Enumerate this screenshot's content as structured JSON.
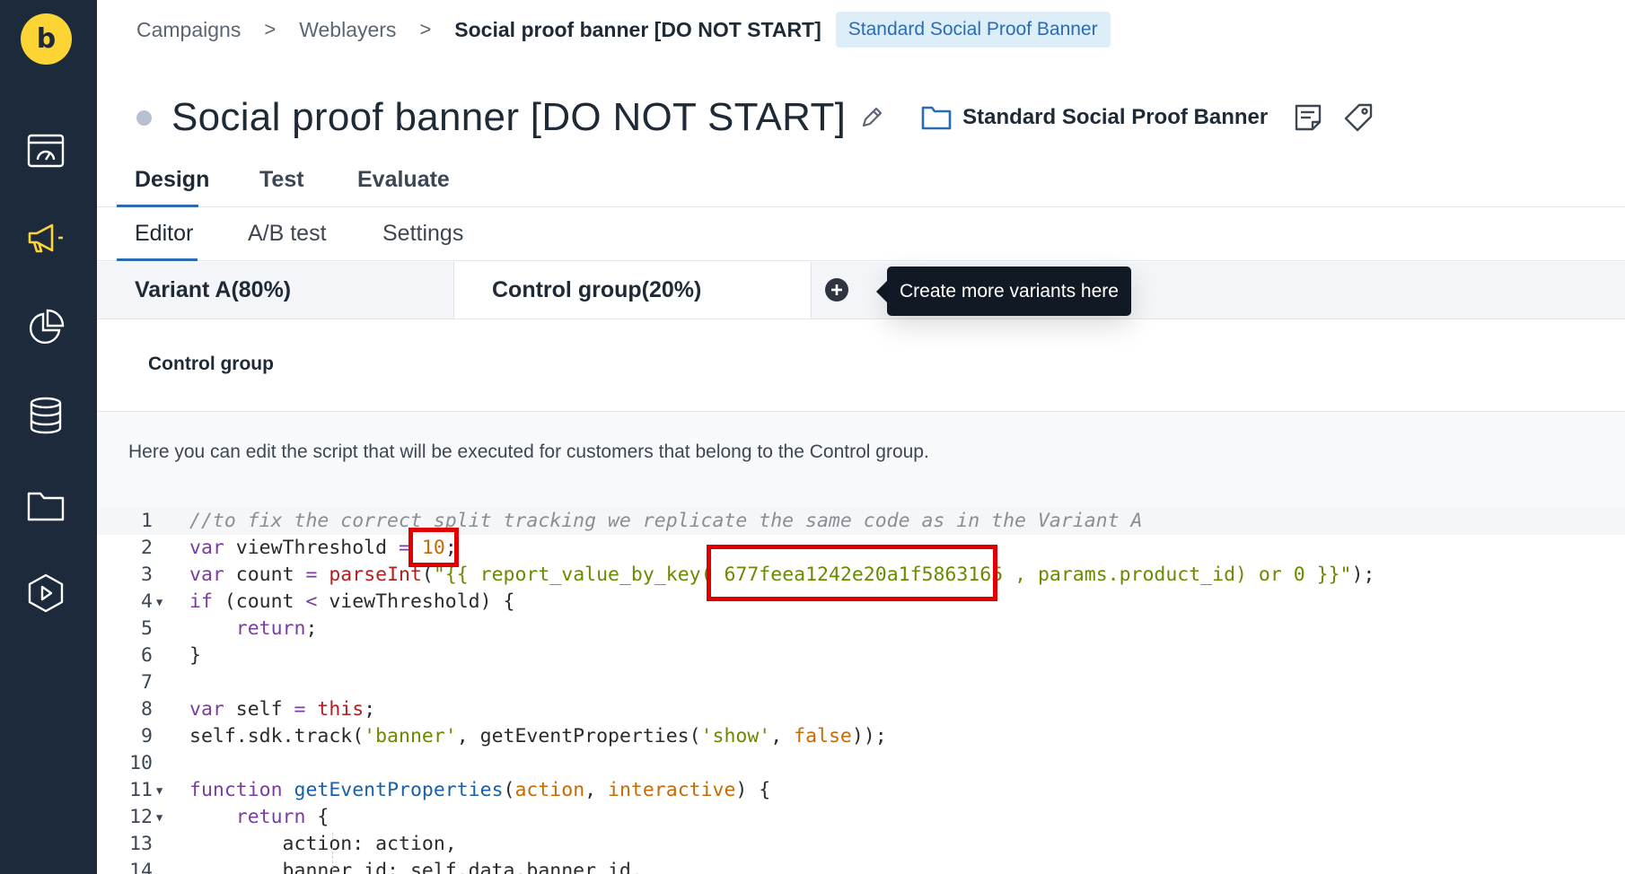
{
  "app": {
    "logo_letter": "b"
  },
  "sidebar": {
    "items": [
      {
        "name": "dashboard",
        "icon": "dashboard-gauge-icon"
      },
      {
        "name": "campaigns",
        "icon": "megaphone-icon",
        "active": true
      },
      {
        "name": "analytics",
        "icon": "pie-chart-icon"
      },
      {
        "name": "data",
        "icon": "database-icon"
      },
      {
        "name": "assets",
        "icon": "folder-icon"
      },
      {
        "name": "playbooks",
        "icon": "play-hexagon-icon"
      }
    ],
    "colors": {
      "background": "#1c2a3b",
      "active": "#fcd535",
      "inactive": "#ffffff"
    }
  },
  "breadcrumb": {
    "items": [
      "Campaigns",
      "Weblayers",
      "Social proof banner [DO NOT START]"
    ],
    "separator": ">",
    "badge": "Standard Social Proof Banner"
  },
  "header": {
    "title": "Social proof banner [DO NOT START]",
    "folder_label": "Standard Social Proof Banner"
  },
  "tabs_primary": [
    "Design",
    "Test",
    "Evaluate"
  ],
  "tabs_secondary": [
    "Editor",
    "A/B test",
    "Settings"
  ],
  "variants": {
    "items": [
      "Variant A(80%)",
      "Control group(20%)"
    ],
    "tooltip": "Create more variants here"
  },
  "section": {
    "label": "Control group",
    "description": "Here you can edit the script that will be executed for customers that belong to the Control group."
  },
  "code": {
    "line_numbers": [
      "1",
      "2",
      "3",
      "4",
      "5",
      "6",
      "7",
      "8",
      "9",
      "10",
      "11",
      "12",
      "13",
      "14"
    ],
    "lines": [
      {
        "parts": [
          {
            "t": "//to fix the correct split tracking we replicate the same code as in the Variant A",
            "c": "c-comment"
          }
        ]
      },
      {
        "parts": [
          {
            "t": "var",
            "c": "c-kw"
          },
          {
            "t": " viewThreshold ",
            "c": ""
          },
          {
            "t": "=",
            "c": "c-op"
          },
          {
            "t": " ",
            "c": ""
          },
          {
            "t": "10",
            "c": "c-num"
          },
          {
            "t": ";",
            "c": ""
          }
        ]
      },
      {
        "parts": [
          {
            "t": "var",
            "c": "c-kw"
          },
          {
            "t": " count ",
            "c": ""
          },
          {
            "t": "=",
            "c": "c-op"
          },
          {
            "t": " ",
            "c": ""
          },
          {
            "t": "parseInt",
            "c": "c-fn"
          },
          {
            "t": "(",
            "c": ""
          },
          {
            "t": "\"{{ report_value_by_key( 677feea1242e20a1f5863165 , params.product_id) or 0 }}\"",
            "c": "c-str"
          },
          {
            "t": ");",
            "c": ""
          }
        ]
      },
      {
        "parts": [
          {
            "t": "if",
            "c": "c-kw"
          },
          {
            "t": " (count ",
            "c": ""
          },
          {
            "t": "<",
            "c": "c-op"
          },
          {
            "t": " viewThreshold) {",
            "c": ""
          }
        ]
      },
      {
        "parts": [
          {
            "t": "    ",
            "c": ""
          },
          {
            "t": "return",
            "c": "c-kw"
          },
          {
            "t": ";",
            "c": ""
          }
        ]
      },
      {
        "parts": [
          {
            "t": "}",
            "c": ""
          }
        ]
      },
      {
        "parts": []
      },
      {
        "parts": [
          {
            "t": "var",
            "c": "c-kw"
          },
          {
            "t": " self ",
            "c": ""
          },
          {
            "t": "=",
            "c": "c-op"
          },
          {
            "t": " ",
            "c": ""
          },
          {
            "t": "this",
            "c": "c-fn"
          },
          {
            "t": ";",
            "c": ""
          }
        ]
      },
      {
        "parts": [
          {
            "t": "self.sdk.track(",
            "c": ""
          },
          {
            "t": "'banner'",
            "c": "c-str"
          },
          {
            "t": ", getEventProperties(",
            "c": ""
          },
          {
            "t": "'show'",
            "c": "c-str"
          },
          {
            "t": ", ",
            "c": ""
          },
          {
            "t": "false",
            "c": "c-bool"
          },
          {
            "t": "));",
            "c": ""
          }
        ]
      },
      {
        "parts": []
      },
      {
        "parts": [
          {
            "t": "function",
            "c": "c-kw"
          },
          {
            "t": " ",
            "c": ""
          },
          {
            "t": "getEventProperties",
            "c": "c-def"
          },
          {
            "t": "(",
            "c": ""
          },
          {
            "t": "action",
            "c": "c-param"
          },
          {
            "t": ", ",
            "c": ""
          },
          {
            "t": "interactive",
            "c": "c-param"
          },
          {
            "t": ") {",
            "c": ""
          }
        ]
      },
      {
        "parts": [
          {
            "t": "    ",
            "c": ""
          },
          {
            "t": "return",
            "c": "c-kw"
          },
          {
            "t": " {",
            "c": ""
          }
        ]
      },
      {
        "parts": [
          {
            "t": "        action: action,",
            "c": ""
          }
        ]
      },
      {
        "parts": [
          {
            "t": "        banner_id: self.data.banner_id,",
            "c": ""
          }
        ]
      }
    ],
    "fold_marker": "▼"
  },
  "annotations": {
    "highlight_color": "#e00000"
  }
}
